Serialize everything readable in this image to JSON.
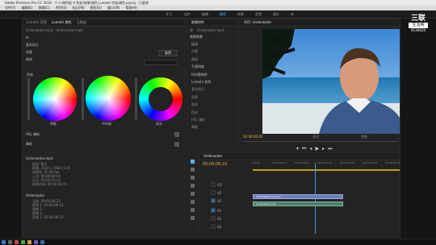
{
  "title_bar": "Adobe Premiere Pro CC 2018 - 个人/调色板-4 色彩/效果/调色 Lumetri 色彩调色.prproj - 已更改",
  "menu": [
    "文件(F)",
    "编辑(E)",
    "剪辑(C)",
    "序列(S)",
    "标记(M)",
    "图形(G)",
    "窗口(W)",
    "帮助(H)"
  ],
  "workspaces": [
    "学习",
    "组件",
    "编辑",
    "颜色",
    "效果",
    "音频",
    "图形",
    "库"
  ],
  "lumetri": {
    "tabs": [
      "Lumetri 范围",
      "Lumetri 颜色",
      "元数据"
    ],
    "clip_name": "Underwater.mp4 - Underwater.mp4",
    "section": "色轮",
    "fx_label": "fx",
    "creative_label": "创意",
    "basic_label": "基本校正",
    "curves_label": "曲线",
    "wheel_labels": [
      "阴影",
      "中间调",
      "高光"
    ],
    "reset_button": "重置",
    "hsl_label": "HSL 辅助",
    "vignette_label": "晕影",
    "color_match_label": "颜色匹配"
  },
  "effect_controls": {
    "tab": "效果控件",
    "sub_tab": "源",
    "clip": "Underwater.mp4",
    "section_label": "视频效果",
    "items": [
      "运动",
      "位置",
      "缩放",
      "不透明度",
      "时间重映射",
      "Lumetri 颜色",
      "基本校正",
      "创意",
      "曲线",
      "色轮",
      "HSL 辅助",
      "晕影"
    ]
  },
  "program": {
    "tab": "节目: Underwater",
    "timecode": "00:00:06:02",
    "fit": "适合",
    "quality": "完整"
  },
  "timeline": {
    "tab": "Underwater",
    "timecode": "00:00:06:22",
    "ruler": [
      "00:00",
      "00:00:04:23",
      "00:00:09:23",
      "00:00:14:23",
      "00:00:19:23",
      "00:00:24:23",
      "00:00:29:23"
    ],
    "tracks": [
      "V3",
      "V2",
      "V1",
      "A1",
      "A2",
      "A3"
    ],
    "clip_v": "Underwater.mp4 [V]",
    "clip_a": "Underwater.mp4"
  },
  "info_panel": {
    "title": "Underwater.mp4",
    "lines": [
      "类型: 影片",
      "视频: 1920 x 1080 (1.0)",
      "帧速率: 25.00 fps",
      "入点: 00:00:00:00",
      "出点: 00:00:20:14",
      "持续时间: 00:00:20:15"
    ],
    "seq_title": "Underwater",
    "seq_lines": [
      "当前: 00:00:06:22",
      "视频 1: 00:00:06:22",
      "视频 2:",
      "视频 3:",
      "音频 1: 00:00:06:22"
    ]
  },
  "logo": {
    "line1": "三联",
    "line2": "生活网",
    "line3": "8136628"
  },
  "colors": {
    "accent": "#5ab1ff",
    "playhead": "#4a90d9",
    "clip_blue": "#6a7dbd",
    "track_on": "#2e6fa8"
  }
}
